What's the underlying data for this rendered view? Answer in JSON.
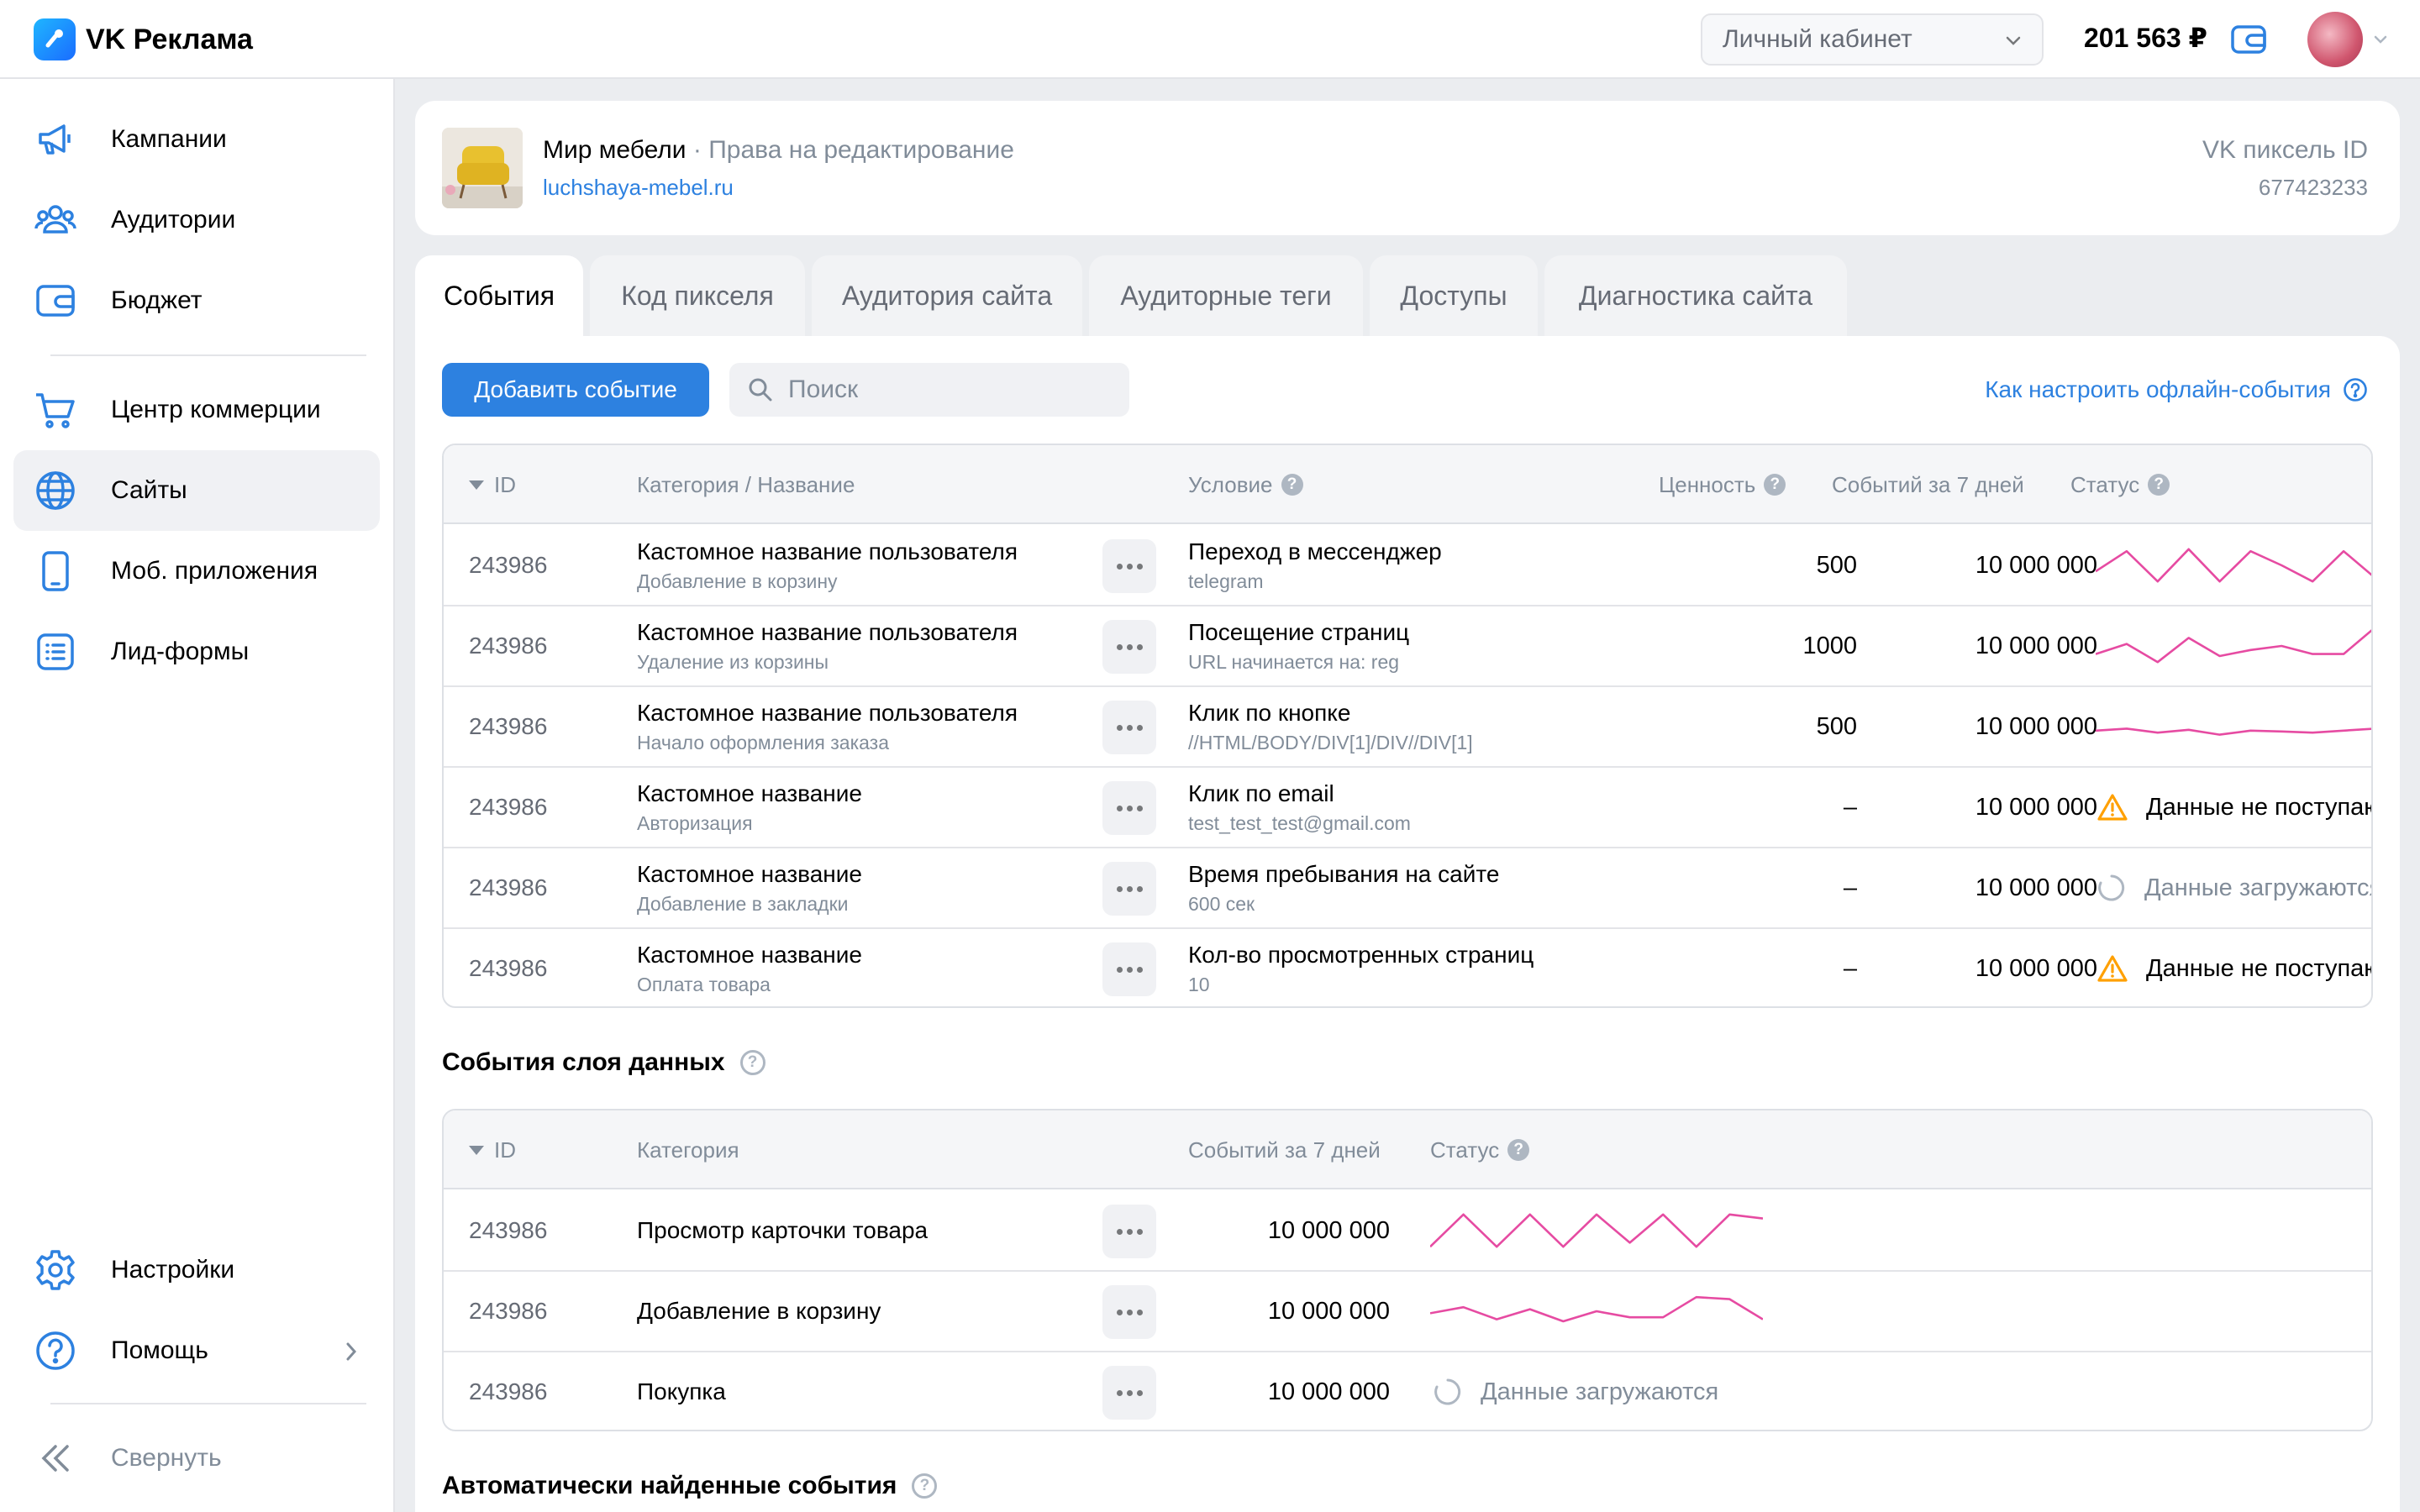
{
  "header": {
    "logo_text": "VK Реклама",
    "account_select": "Личный кабинет",
    "balance": "201 563 ₽"
  },
  "sidebar": {
    "items": [
      {
        "label": "Кампании",
        "icon": "megaphone-icon"
      },
      {
        "label": "Аудитории",
        "icon": "users-icon"
      },
      {
        "label": "Бюджет",
        "icon": "wallet-icon"
      },
      {
        "label": "Центр коммерции",
        "icon": "cart-icon"
      },
      {
        "label": "Сайты",
        "icon": "globe-icon",
        "active": true
      },
      {
        "label": "Моб. приложения",
        "icon": "phone-icon"
      },
      {
        "label": "Лид-формы",
        "icon": "list-icon"
      }
    ],
    "bottom": [
      {
        "label": "Настройки",
        "icon": "gear-icon"
      },
      {
        "label": "Помощь",
        "icon": "help-icon"
      }
    ],
    "collapse_label": "Свернуть"
  },
  "site": {
    "name": "Мир мебели",
    "separator": "·",
    "rights": "Права на редактирование",
    "url": "luchshaya-mebel.ru",
    "pixel_label": "VK пиксель ID",
    "pixel_id": "677423233"
  },
  "tabs": [
    "События",
    "Код пикселя",
    "Аудитория сайта",
    "Аудиторные теги",
    "Доступы",
    "Диагностика сайта"
  ],
  "toolbar": {
    "add_event": "Добавить событие",
    "search_placeholder": "Поиск",
    "help_link": "Как настроить офлайн-события"
  },
  "events_table": {
    "columns": [
      "ID",
      "Категория / Название",
      "Условие",
      "Ценность",
      "Событий за 7 дней",
      "Статус"
    ],
    "rows": [
      {
        "id": "243986",
        "name": "Кастомное название пользователя",
        "category": "Добавление в корзину",
        "condition": "Переход в мессенджер",
        "condition_value": "telegram",
        "value": "500",
        "count": "10 000 000",
        "status_type": "chart",
        "spark": [
          0.35,
          0.85,
          0.1,
          0.9,
          0.1,
          0.85,
          0.5,
          0.1,
          0.85,
          0.2
        ]
      },
      {
        "id": "243986",
        "name": "Кастомное название пользователя",
        "category": "Удаление из корзины",
        "condition": "Посещение страниц",
        "condition_value": "URL начинается на: reg",
        "value": "1000",
        "count": "10 000 000",
        "status_type": "chart",
        "spark": [
          0.3,
          0.55,
          0.1,
          0.7,
          0.25,
          0.4,
          0.5,
          0.3,
          0.3,
          0.95
        ]
      },
      {
        "id": "243986",
        "name": "Кастомное название пользователя",
        "category": "Начало оформления заказа",
        "condition": "Клик по кнопке",
        "condition_value": "//HTML/BODY/DIV[1]/DIV//DIV[1]",
        "value": "500",
        "count": "10 000 000",
        "status_type": "chart",
        "spark": [
          0.4,
          0.45,
          0.35,
          0.42,
          0.3,
          0.4,
          0.38,
          0.35,
          0.4,
          0.45
        ]
      },
      {
        "id": "243986",
        "name": "Кастомное название",
        "category": "Авторизация",
        "condition": "Клик по email",
        "condition_value": "test_test_test@gmail.com",
        "value": "–",
        "count": "10 000 000",
        "status_type": "warning",
        "status_text": "Данные не поступают"
      },
      {
        "id": "243986",
        "name": "Кастомное название",
        "category": "Добавление в закладки",
        "condition": "Время пребывания на сайте",
        "condition_value": "600 сек",
        "value": "–",
        "count": "10 000 000",
        "status_type": "loading",
        "status_text": "Данные загружаются"
      },
      {
        "id": "243986",
        "name": "Кастомное название",
        "category": "Оплата товара",
        "condition": "Кол-во просмотренных страниц",
        "condition_value": "10",
        "value": "–",
        "count": "10 000 000",
        "status_type": "warning",
        "status_text": "Данные не поступают"
      }
    ]
  },
  "datalayer": {
    "title": "События слоя данных",
    "columns": [
      "ID",
      "Категория",
      "Событий за 7 дней",
      "Статус"
    ],
    "rows": [
      {
        "id": "243986",
        "category": "Просмотр карточки товара",
        "count": "10 000 000",
        "status_type": "chart",
        "spark": [
          0.1,
          0.9,
          0.1,
          0.9,
          0.1,
          0.9,
          0.2,
          0.9,
          0.1,
          0.9,
          0.8
        ]
      },
      {
        "id": "243986",
        "category": "Добавление в корзину",
        "count": "10 000 000",
        "status_type": "chart",
        "spark": [
          0.45,
          0.6,
          0.3,
          0.55,
          0.25,
          0.5,
          0.35,
          0.35,
          0.85,
          0.8,
          0.3
        ]
      },
      {
        "id": "243986",
        "category": "Покупка",
        "count": "10 000 000",
        "status_type": "loading",
        "status_text": "Данные загружаются"
      }
    ]
  },
  "auto": {
    "title": "Автоматически найденные события"
  },
  "colors": {
    "accent": "#2d81e0",
    "spark": "#e64ba2",
    "warning": "#ffa000"
  }
}
